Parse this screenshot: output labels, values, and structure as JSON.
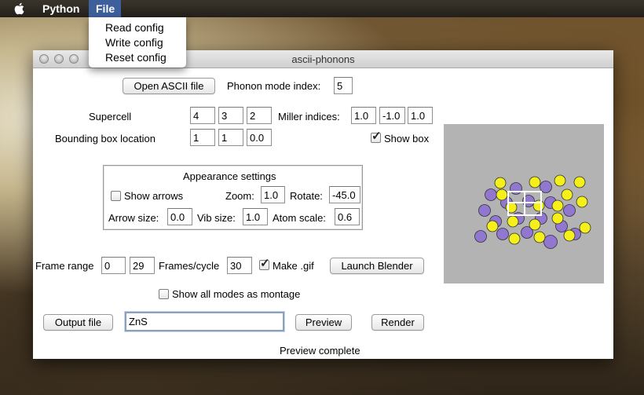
{
  "menubar": {
    "apple_icon": "apple-logo-icon",
    "app_menu": "Python",
    "file_menu": "File"
  },
  "file_dropdown": {
    "items": [
      "Read config",
      "Write config",
      "Reset config"
    ]
  },
  "window": {
    "title": "ascii-phonons",
    "traffic_lights": [
      "close",
      "minimize",
      "zoom"
    ]
  },
  "controls": {
    "open_ascii_file": "Open ASCII file",
    "phonon_mode_label": "Phonon mode index:",
    "phonon_mode_value": "5",
    "supercell_label": "Supercell",
    "supercell": [
      "4",
      "3",
      "2"
    ],
    "miller_label": "Miller indices:",
    "miller": [
      "1.0",
      "-1.0",
      "1.0"
    ],
    "bbox_label": "Bounding box location",
    "bbox": [
      "1",
      "1",
      "0.0"
    ],
    "show_box_label": "Show box",
    "show_box_checked": true
  },
  "appearance": {
    "title": "Appearance settings",
    "show_arrows_label": "Show arrows",
    "show_arrows_checked": false,
    "zoom_label": "Zoom:",
    "zoom": "1.0",
    "rotate_label": "Rotate:",
    "rotate": "-45.0",
    "arrow_size_label": "Arrow size:",
    "arrow_size": "0.0",
    "vib_size_label": "Vib size:",
    "vib_size": "1.0",
    "atom_scale_label": "Atom scale:",
    "atom_scale": "0.6"
  },
  "animation": {
    "frame_range_label": "Frame range",
    "frame_start": "0",
    "frame_end": "29",
    "frames_per_cycle_label": "Frames/cycle",
    "frames_per_cycle": "30",
    "make_gif_label": "Make .gif",
    "make_gif_checked": true,
    "launch_blender": "Launch Blender",
    "montage_label": "Show all modes as montage",
    "montage_checked": false
  },
  "output": {
    "output_file_button": "Output file",
    "output_file_value": "ZnS",
    "preview_button": "Preview",
    "render_button": "Render"
  },
  "status": "Preview complete",
  "colors": {
    "menu_highlight": "#3d5f9c",
    "atom_purple": "#9177d0",
    "atom_yellow": "#f5f019",
    "preview_bg": "#b3b3b3"
  }
}
